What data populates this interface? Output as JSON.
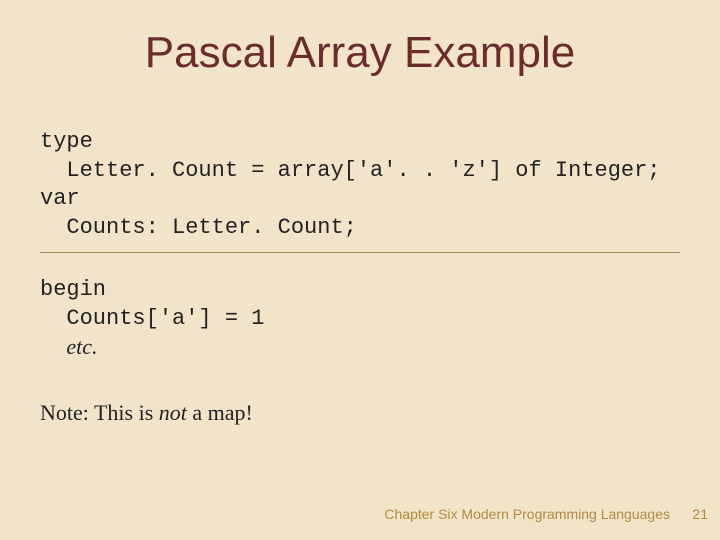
{
  "title": "Pascal Array Example",
  "code1": {
    "l1": "type",
    "l2": "  Letter. Count = array['a'. . 'z'] of Integer;",
    "l3": "var",
    "l4": "  Counts: Letter. Count;"
  },
  "code2": {
    "l1": "begin",
    "l2": "  Counts['a'] = 1",
    "etc_indent": "  ",
    "etc": "etc."
  },
  "note": {
    "prefix": "Note: This is ",
    "not": "not",
    "suffix": " a map!"
  },
  "footer": "Chapter Six    Modern Programming Languages",
  "page": "21"
}
